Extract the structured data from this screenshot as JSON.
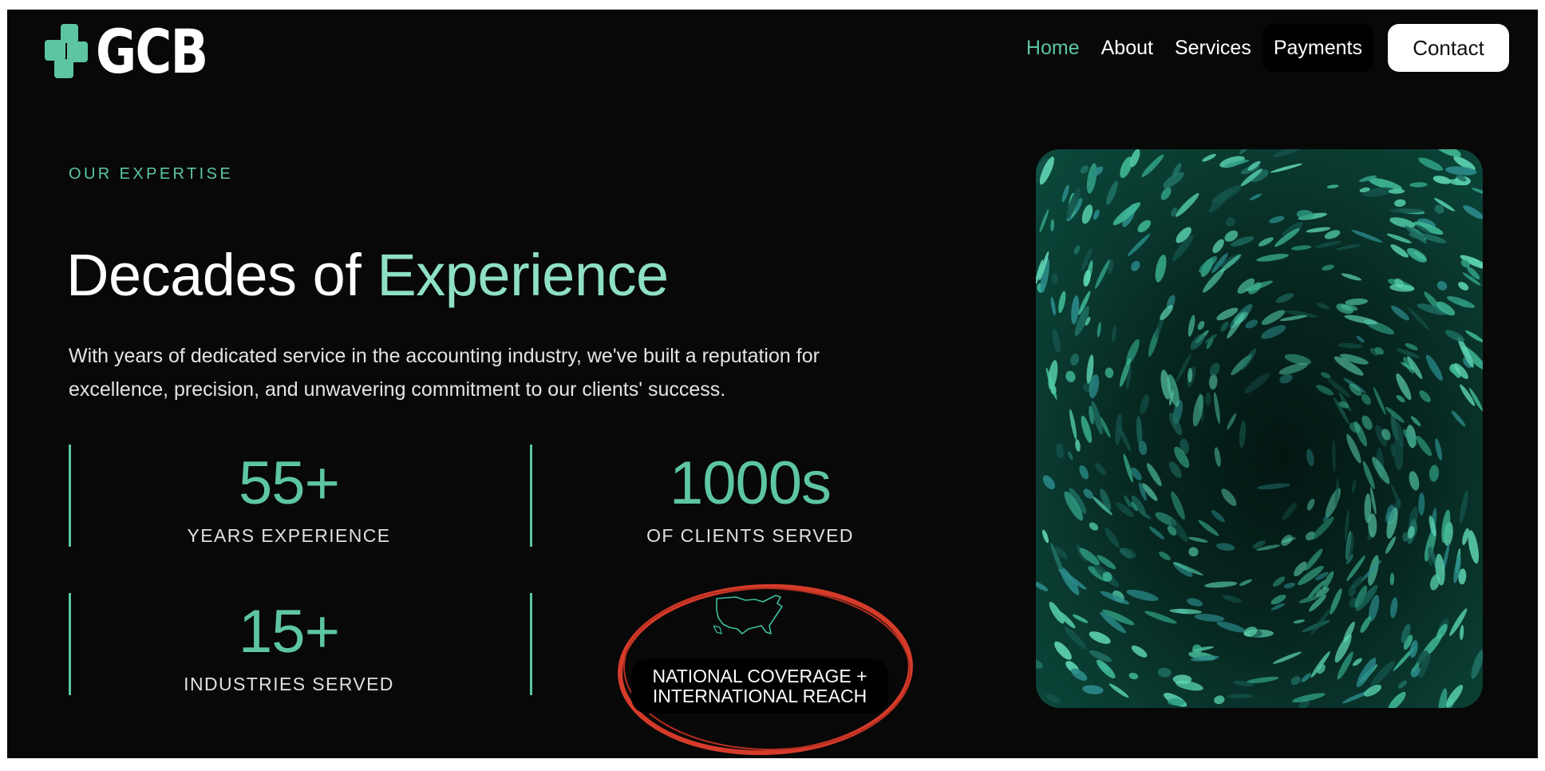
{
  "brand": {
    "name": "GCB",
    "accent": "#5dc6a0",
    "logo_icon": "cross-blocks-logo-icon"
  },
  "nav": {
    "links": [
      "Home",
      "About",
      "Services",
      "Payments"
    ],
    "active": "Home",
    "contact_label": "Contact"
  },
  "hero": {
    "eyebrow": "OUR EXPERTISE",
    "headline_plain": "Decades of ",
    "headline_accent": "Experience",
    "description": "With years of dedicated service in the accounting industry, we've built a reputation for excellence, precision, and unwavering commitment to our clients' success."
  },
  "stats": [
    {
      "value": "55+",
      "label": "YEARS EXPERIENCE"
    },
    {
      "value": "1000s",
      "label": "OF CLIENTS SERVED"
    },
    {
      "value": "15+",
      "label": "INDUSTRIES SERVED"
    }
  ],
  "reach": {
    "icon": "usa-map-icon",
    "line1": "NATIONAL COVERAGE +",
    "line2": "INTERNATIONAL REACH",
    "highlight_color": "#d63b2a"
  },
  "image": {
    "subject": "abstract-green-feathers-artwork"
  }
}
